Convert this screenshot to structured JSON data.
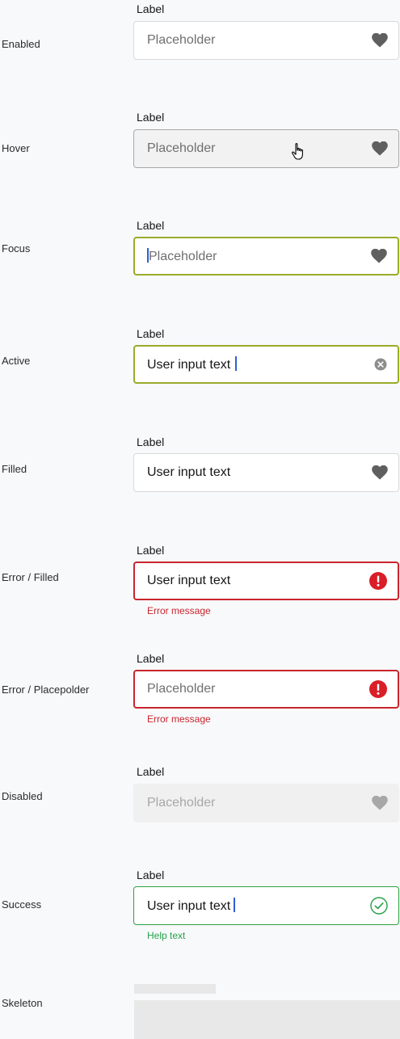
{
  "states": [
    {
      "id": "enabled",
      "name": "Enabled",
      "label": "Label",
      "text": "Placeholder"
    },
    {
      "id": "hover",
      "name": "Hover",
      "label": "Label",
      "text": "Placeholder"
    },
    {
      "id": "focus",
      "name": "Focus",
      "label": "Label",
      "text": "Placeholder"
    },
    {
      "id": "active",
      "name": "Active",
      "label": "Label",
      "text": "User input text"
    },
    {
      "id": "filled",
      "name": "Filled",
      "label": "Label",
      "text": "User input text"
    },
    {
      "id": "error_filled",
      "name": "Error / Filled",
      "label": "Label",
      "text": "User input text",
      "message": "Error message"
    },
    {
      "id": "error_placeholder",
      "name": "Error / Placepolder",
      "label": "Label",
      "text": "Placeholder",
      "message": "Error message"
    },
    {
      "id": "disabled",
      "name": "Disabled",
      "label": "Label",
      "text": "Placeholder"
    },
    {
      "id": "success",
      "name": "Success",
      "label": "Label",
      "text": "User input text",
      "message": "Help text"
    },
    {
      "id": "skeleton",
      "name": "Skeleton"
    }
  ],
  "icons": {
    "default": "heart-icon",
    "active": "clear-icon",
    "error": "error-icon",
    "success": "checkmark-circle-icon",
    "cursor": "hand-pointer-icon"
  },
  "colors": {
    "focus_border": "#9aab2a",
    "error": "#c9252d",
    "success": "#24a148",
    "caret": "#2d5fd3"
  }
}
